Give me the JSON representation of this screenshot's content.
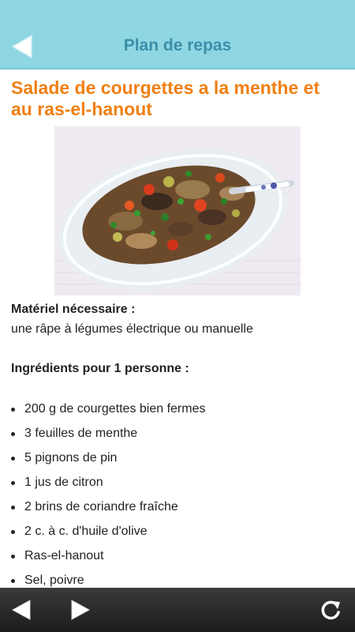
{
  "header": {
    "title": "Plan de repas",
    "back_icon": "back-arrow-icon"
  },
  "recipe": {
    "title": "Salade de courgettes a la menthe et au ras-el-hanout",
    "equipment_label": "Matériel nécessaire :",
    "equipment": "une râpe à légumes électrique ou manuelle",
    "ingredients_label": "Ingrédients pour 1 personne :",
    "ingredients": [
      "200 g de courgettes bien fermes",
      "3 feuilles de menthe",
      "5 pignons de pin",
      "1 jus de citron",
      "2 brins de coriandre fraîche",
      "2 c. à c. d'huile d'olive",
      "Ras-el-hanout",
      "Sel, poivre"
    ]
  },
  "footer": {
    "prev_icon": "prev-arrow-icon",
    "next_icon": "next-arrow-icon",
    "refresh_icon": "refresh-icon"
  },
  "colors": {
    "header_bg": "#8fd6e3",
    "title_color": "#3b8fa8",
    "accent": "#f07f12",
    "footer_bg": "#1c1c1c"
  }
}
